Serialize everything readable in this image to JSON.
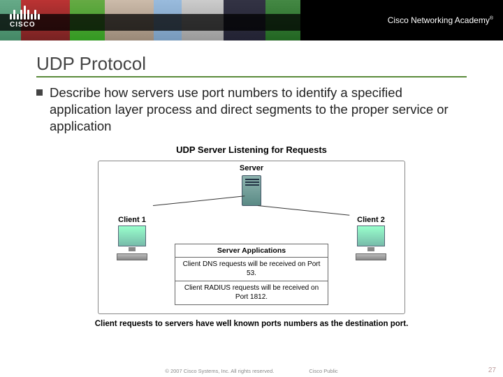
{
  "banner": {
    "brand": "CISCO",
    "academy": "Cisco Networking Academy",
    "tm": "®"
  },
  "slide": {
    "title": "UDP Protocol",
    "bullet": "Describe how servers use port numbers to identify a specified application layer process and direct segments to the proper service or application"
  },
  "diagram": {
    "title": "UDP Server Listening for Requests",
    "server_label": "Server",
    "client1_label": "Client 1",
    "client2_label": "Client 2",
    "apps_title": "Server Applications",
    "dns_line": "Client DNS requests will be received on Port 53.",
    "radius_line": "Client RADIUS requests will be received on Port 1812.",
    "caption_bold": "Client requests to servers have well known ports numbers as the destination port."
  },
  "footer": {
    "copyright": "© 2007 Cisco Systems, Inc. All rights reserved.",
    "scope": "Cisco Public",
    "page": "27"
  }
}
